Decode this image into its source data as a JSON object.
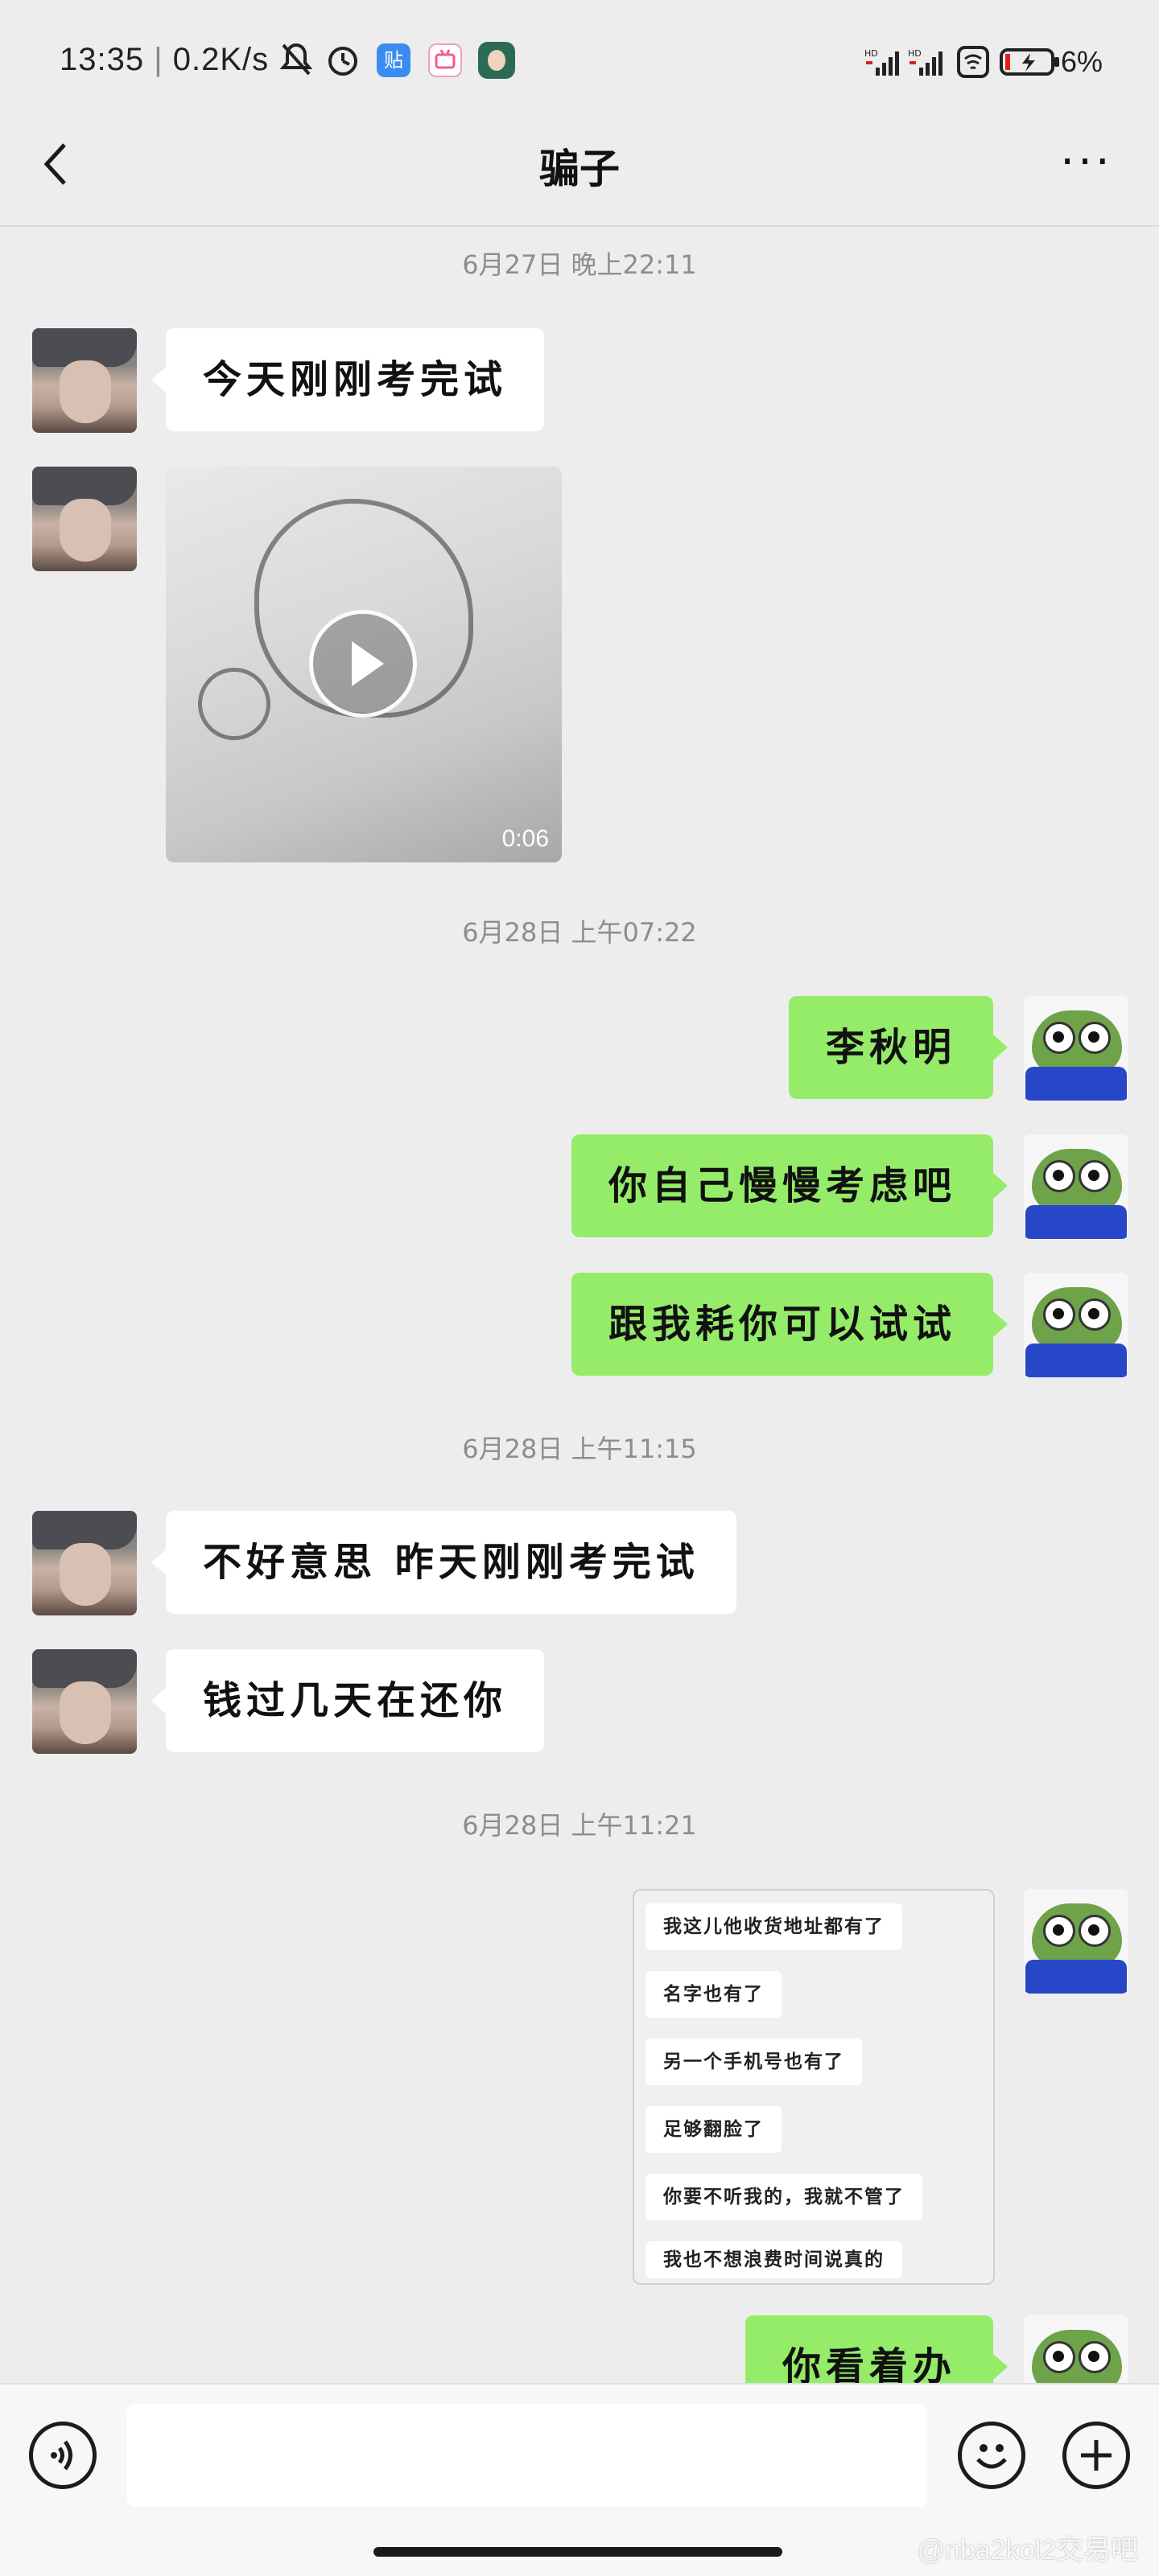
{
  "status_bar": {
    "time": "13:35",
    "speed": "0.2K/s",
    "icons": [
      "mute-icon",
      "alarm-icon",
      "tieba-app-icon",
      "bilibili-app-icon",
      "avatar-app-icon"
    ],
    "signal_icons": [
      "signal-hd-1-icon",
      "signal-hd-2-icon",
      "wifi-icon",
      "battery-icon"
    ],
    "battery": "6%"
  },
  "header": {
    "title": "骗子",
    "more_label": "···"
  },
  "timestamps": [
    "6月27日 晚上22:11",
    "6月28日 上午07:22",
    "6月28日 上午11:15",
    "6月28日 上午11:21"
  ],
  "messages": {
    "m1": "今天刚刚考完试",
    "video_duration": "0:06",
    "m3": "李秋明",
    "m4": "你自己慢慢考虑吧",
    "m5": "跟我耗你可以试试",
    "m6": "不好意思 昨天刚刚考完试",
    "m7": "钱过几天在还你",
    "m9": "你看着办"
  },
  "screenshot_lines": [
    "我这儿他收货地址都有了",
    "名字也有了",
    "另一个手机号也有了",
    "足够翻脸了",
    "你要不听我的，我就不管了",
    "我也不想浪费时间说真的"
  ],
  "watermark": "@nba2kol2交易吧",
  "colors": {
    "background": "#ededed",
    "sent_bubble": "#95ec69",
    "received_bubble": "#ffffff",
    "timestamp": "#8d8d8d"
  }
}
